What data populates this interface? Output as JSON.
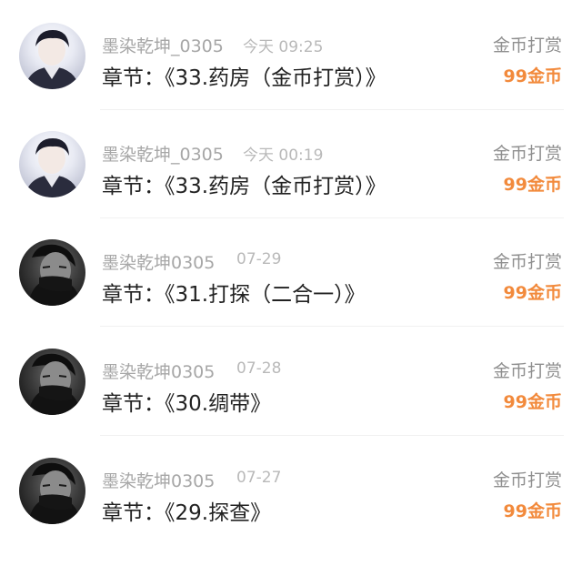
{
  "colors": {
    "username": "#a7a7a7",
    "time": "#b9b9b9",
    "chapter": "#222222",
    "type": "#8f8f8f",
    "amount": "#f28a3c"
  },
  "rewards": [
    {
      "avatar_icon": "user-avatar-icon",
      "username": "墨染乾坤_0305",
      "time": "今天 09:25",
      "chapter": "章节：《33.药房（金币打赏）》",
      "type": "金币打赏",
      "amount": "99金币"
    },
    {
      "avatar_icon": "user-avatar-icon",
      "username": "墨染乾坤_0305",
      "time": "今天 00:19",
      "chapter": "章节：《33.药房（金币打赏）》",
      "type": "金币打赏",
      "amount": "99金币"
    },
    {
      "avatar_icon": "user-avatar-icon",
      "username": "墨染乾坤0305",
      "time": "07-29",
      "chapter": "章节：《31.打探（二合一）》",
      "type": "金币打赏",
      "amount": "99金币"
    },
    {
      "avatar_icon": "user-avatar-icon",
      "username": "墨染乾坤0305",
      "time": "07-28",
      "chapter": "章节：《30.绸带》",
      "type": "金币打赏",
      "amount": "99金币"
    },
    {
      "avatar_icon": "user-avatar-icon",
      "username": "墨染乾坤0305",
      "time": "07-27",
      "chapter": "章节：《29.探查》",
      "type": "金币打赏",
      "amount": "99金币"
    }
  ]
}
